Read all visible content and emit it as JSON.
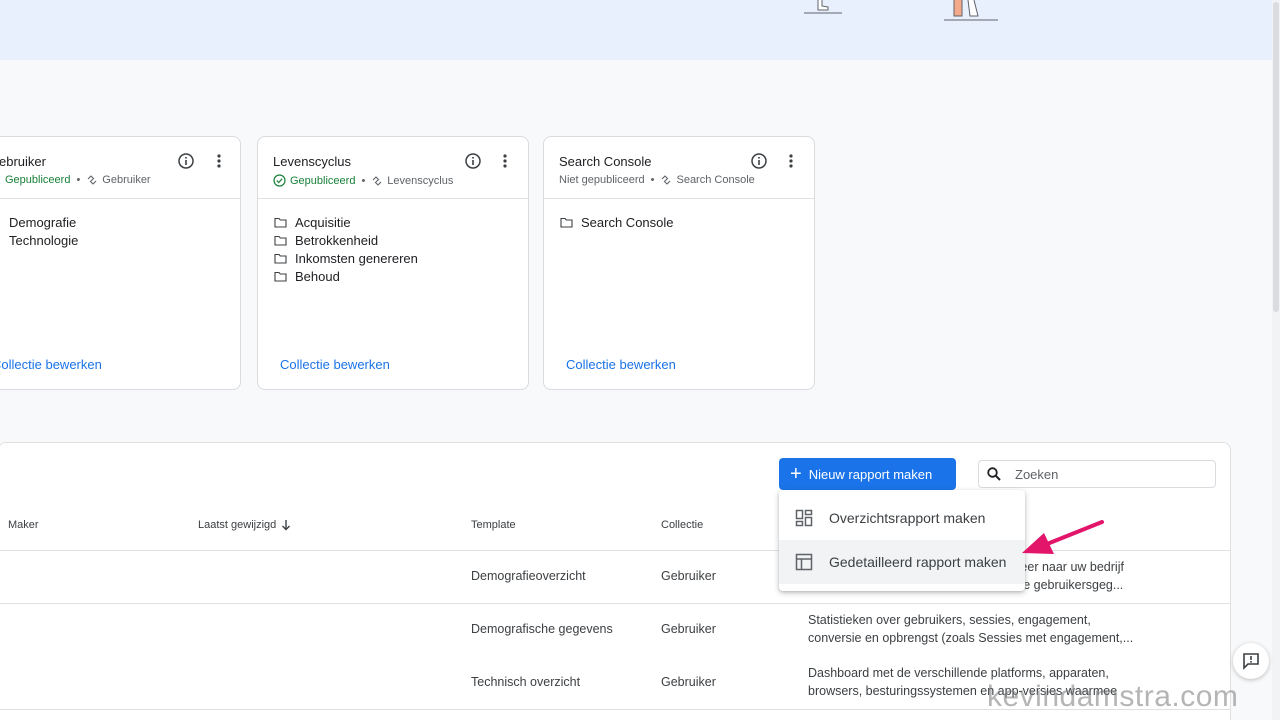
{
  "collections": [
    {
      "title": "ebruiker",
      "status": "Gepubliceerd",
      "published": true,
      "collection": "Gebruiker",
      "items": [
        "Demografie",
        "Technologie"
      ],
      "edit_label": "Collectie bewerken"
    },
    {
      "title": "Levenscyclus",
      "status": "Gepubliceerd",
      "published": true,
      "collection": "Levenscyclus",
      "items": [
        "Acquisitie",
        "Betrokkenheid",
        "Inkomsten genereren",
        "Behoud"
      ],
      "edit_label": "Collectie bewerken"
    },
    {
      "title": "Search Console",
      "status": "Niet gepubliceerd",
      "published": false,
      "collection": "Search Console",
      "items": [
        "Search Console"
      ],
      "edit_label": "Collectie bewerken"
    }
  ],
  "toolbar": {
    "new_report_label": "Nieuw rapport maken",
    "search_placeholder": "Zoeken"
  },
  "table": {
    "headers": {
      "maker": "Maker",
      "last_modified": "Laatst gewijzigd",
      "template": "Template",
      "collection": "Collectie"
    },
    "rows": [
      {
        "template": "Demografieoverzicht",
        "collection": "Gebruiker",
        "description": [
          "rkeer naar uw bedrijf",
          "che gebruikersgeg..."
        ]
      },
      {
        "template": "Demografische gegevens",
        "collection": "Gebruiker",
        "description": [
          "Statistieken over gebruikers, sessies, engagement,",
          "conversie en opbrengst (zoals Sessies met engagement,..."
        ]
      },
      {
        "template": "Technisch overzicht",
        "collection": "Gebruiker",
        "description": [
          "Dashboard met de verschillende platforms, apparaten,",
          "browsers, besturingssystemen en app-versies waarmee"
        ]
      }
    ]
  },
  "menu": {
    "items": [
      {
        "label": "Overzichtsrapport maken",
        "icon": "dashboard-icon"
      },
      {
        "label": "Gedetailleerd rapport maken",
        "icon": "table-icon"
      }
    ]
  },
  "watermark": "kevindamstra.com",
  "colors": {
    "accent": "#1a73e8",
    "published": "#188038",
    "annotation_arrow": "#e3156b",
    "banner": "#e8f0fe"
  }
}
